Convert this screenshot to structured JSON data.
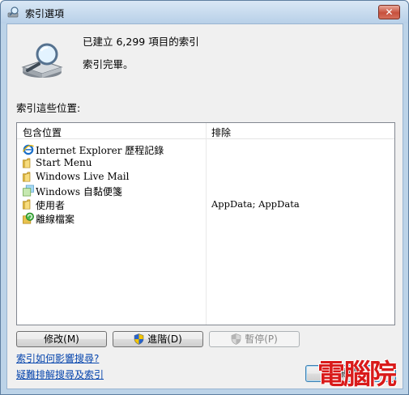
{
  "window": {
    "title": "索引選項",
    "close_label": "✕"
  },
  "header": {
    "title": "已建立 6,299 項目的索引",
    "status": "索引完畢。"
  },
  "locations_label": "索引這些位置:",
  "list": {
    "columns": [
      "包含位置",
      "排除"
    ],
    "rows": [
      {
        "name": "Internet Explorer 歷程記錄",
        "excluded": "",
        "icon": "internet-explorer-icon"
      },
      {
        "name": "Start Menu",
        "excluded": "",
        "icon": "folder-icon"
      },
      {
        "name": "Windows Live Mail",
        "excluded": "",
        "icon": "folder-icon"
      },
      {
        "name": "Windows 自黏便箋",
        "excluded": "",
        "icon": "sticky-notes-icon"
      },
      {
        "name": "使用者",
        "excluded": "AppData; AppData",
        "icon": "folder-icon"
      },
      {
        "name": "離線檔案",
        "excluded": "",
        "icon": "offline-files-icon"
      }
    ]
  },
  "buttons": {
    "modify": "修改(M)",
    "advanced": "進階(D)",
    "pause": "暫停(P)",
    "close": "關閉"
  },
  "links": {
    "search_effect": "索引如何影響搜尋?",
    "troubleshoot": "疑難排解搜尋及索引"
  },
  "watermark": "電腦院",
  "colors": {
    "frame": "#bcd3e8",
    "client": "#f0f0f0",
    "link": "#0645ad",
    "watermark": "#d91a1a"
  }
}
